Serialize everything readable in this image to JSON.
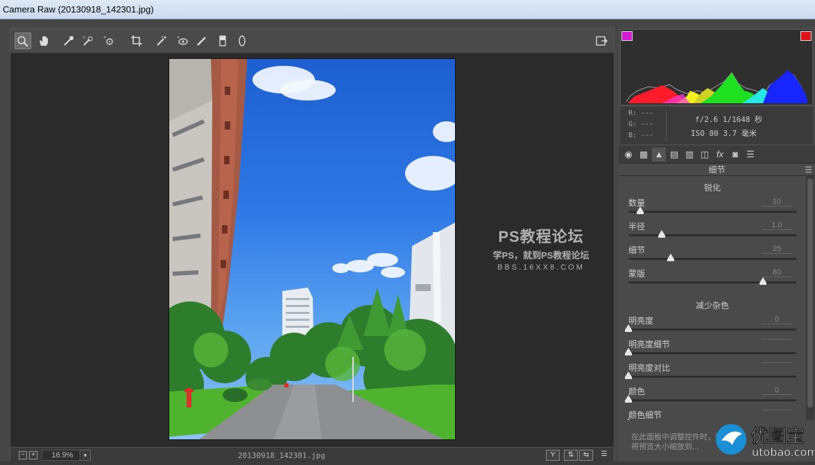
{
  "window": {
    "title": "Camera Raw (20130918_142301.jpg)"
  },
  "toolbar": {
    "tools": [
      "zoom-icon",
      "hand-icon",
      "white-balance-icon",
      "color-sampler-icon",
      "target-adjust-icon",
      "crop-icon",
      "spot-removal-icon",
      "red-eye-icon",
      "adjustment-brush-icon",
      "graduated-filter-icon",
      "radial-filter-icon"
    ],
    "open-prefs-icon": "export-icon"
  },
  "preview": {
    "watermark_title": "PS教程论坛",
    "watermark_sub": "学PS，就到PS教程论坛",
    "watermark_url": "BBS.16XX8.COM"
  },
  "status": {
    "zoom_minus": "−",
    "zoom_plus": "+",
    "zoom": "16.9%",
    "filename": "20130918_142301.jpg",
    "view_y": "Y",
    "view_swap": "⇅",
    "view_copy": "⇆",
    "view_settings": "☰"
  },
  "info": {
    "r": "R:  ---",
    "g": "G:  ---",
    "b": "B:  ---",
    "aperture_shutter": "f/2.6   1/1648 秒",
    "iso_focal": "ISO 80   3.7 毫米"
  },
  "panel": {
    "title": "细节",
    "sharpen": {
      "heading": "锐化",
      "sliders": [
        {
          "label": "数量",
          "value": "10",
          "pos": 0.07
        },
        {
          "label": "半径",
          "value": "1.0",
          "pos": 0.2
        },
        {
          "label": "细节",
          "value": "25",
          "pos": 0.25
        },
        {
          "label": "蒙版",
          "value": "80",
          "pos": 0.8
        }
      ]
    },
    "noise": {
      "heading": "减少杂色",
      "sliders": [
        {
          "label": "明亮度",
          "value": "0",
          "pos": 0.0
        },
        {
          "label": "明亮度细节",
          "value": "",
          "pos": 0.0
        },
        {
          "label": "明亮度对比",
          "value": "",
          "pos": 0.0
        },
        {
          "label": "颜色",
          "value": "0",
          "pos": 0.0
        },
        {
          "label": "颜色细节",
          "value": "",
          "pos": 0.0
        }
      ]
    },
    "tip": "在此面板中调整控件时，请将预览大小缩放到..."
  },
  "brand": {
    "name": "优图宝",
    "url": "utobao.com"
  },
  "colors": {
    "accent": "#2f78e6",
    "hist_red": "#ff1b2a",
    "hist_green": "#1ee020",
    "hist_blue": "#1726ff",
    "hist_yellow": "#f6f020"
  }
}
